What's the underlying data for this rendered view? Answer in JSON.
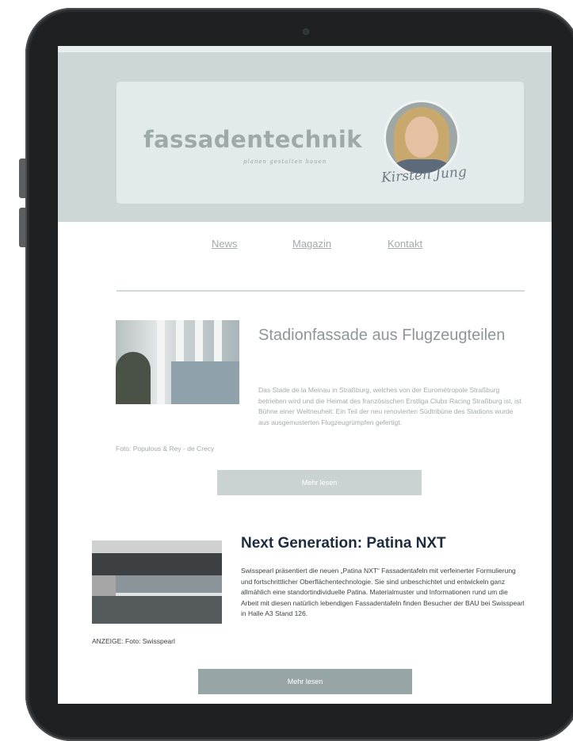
{
  "header": {
    "logo": "fassadentechnik",
    "tagline": "planen gestalten bauen",
    "signature": "Kirsten Jung"
  },
  "nav": {
    "items": [
      {
        "label": "News"
      },
      {
        "label": "Magazin"
      },
      {
        "label": "Kontakt"
      }
    ]
  },
  "articles": [
    {
      "title": "Stadionfassade aus Flugzeugteilen",
      "caption": "Foto: Populous & Rey - de Crecy",
      "body": "Das Stade de la Meinau in Straßburg, welches von der Eurométropole Straßburg betrieben wird und die Heimat des französischen Erstliga Clubs Racing Straßburg ist, ist Bühne einer Weltneuheit: Ein Teil der neu renovierten Südtribüne des Stadions wurde aus ausgemusterten Flugzeugrümpfen gefertigt.",
      "button": "Mehr lesen"
    },
    {
      "title": "Next Generation: Patina NXT",
      "caption": "ANZEIGE: Foto: Swisspearl",
      "body": "Swisspearl präsentiert die neuen „Patina NXT“ Fassadentafeln mit verfeinerter Formulierung und fortschrittlicher Oberflächentechnologie. Sie sind unbeschichtet und entwickeln ganz allmählich eine standortindividuelle Patina. Materialmuster und Informationen rund um die Arbeit mit diesen natürlich lebendigen Fassadentafeln finden Besucher der BAU bei Swisspearl in Halle A3 Stand 126.",
      "button": "Mehr lesen"
    }
  ]
}
